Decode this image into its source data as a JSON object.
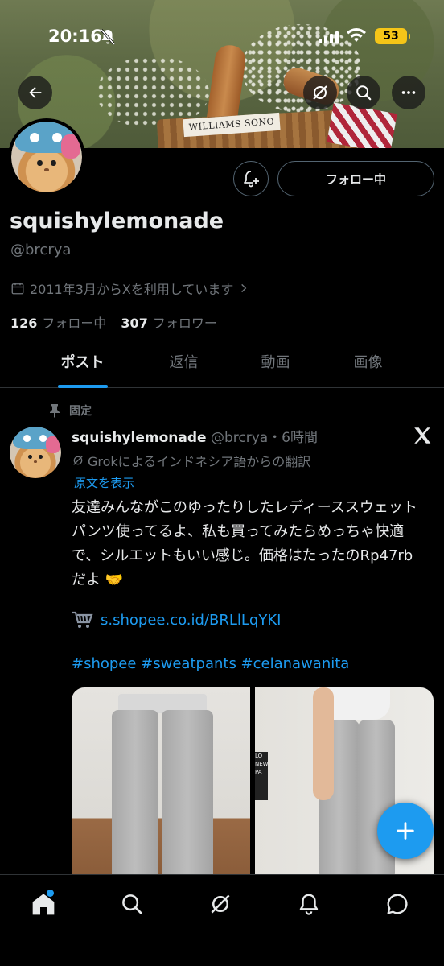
{
  "status_bar": {
    "time": "20:16",
    "battery": "53"
  },
  "profile": {
    "display_name": "squishylemonade",
    "handle": "@brcrya",
    "joined": "2011年3月からXを利用しています",
    "following_count": "126",
    "following_label": "フォロー中",
    "followers_count": "307",
    "followers_label": "フォロワー",
    "follow_button": "フォロー中"
  },
  "banner": {
    "basket_text": "WILLIAMS SONO"
  },
  "tabs": [
    {
      "label": "ポスト",
      "active": true
    },
    {
      "label": "返信"
    },
    {
      "label": "動画"
    },
    {
      "label": "画像"
    }
  ],
  "post": {
    "pinned_label": "固定",
    "author": "squishylemonade",
    "meta": "@brcrya・6時間",
    "translated_from": "Grokによるインドネシア語からの翻訳",
    "show_original": "原文を表示",
    "body": "友達みんながこのゆったりしたレディーススウェットパンツ使ってるよ、私も買ってみたらめっちゃ快適で、シルエットもいい感じ。価格はたったのRp47rbだよ 🤝",
    "link": "s.shopee.co.id/BRLlLqYKI",
    "hashtags": "#shopee #sweatpants #celanawanita",
    "image_sign": "LO NEW PA"
  },
  "colors": {
    "accent": "#1d9bf0",
    "background": "#000000",
    "muted": "#71767b",
    "text": "#e7e9ea"
  },
  "icons": [
    "back-arrow-icon",
    "grok-icon",
    "search-icon",
    "more-icon",
    "notify-bell-icon",
    "calendar-icon",
    "pin-icon",
    "x-logo-icon",
    "cart-icon",
    "compose-plus-icon",
    "home-icon",
    "explore-icon",
    "grok-nav-icon",
    "notifications-icon",
    "messages-icon"
  ]
}
